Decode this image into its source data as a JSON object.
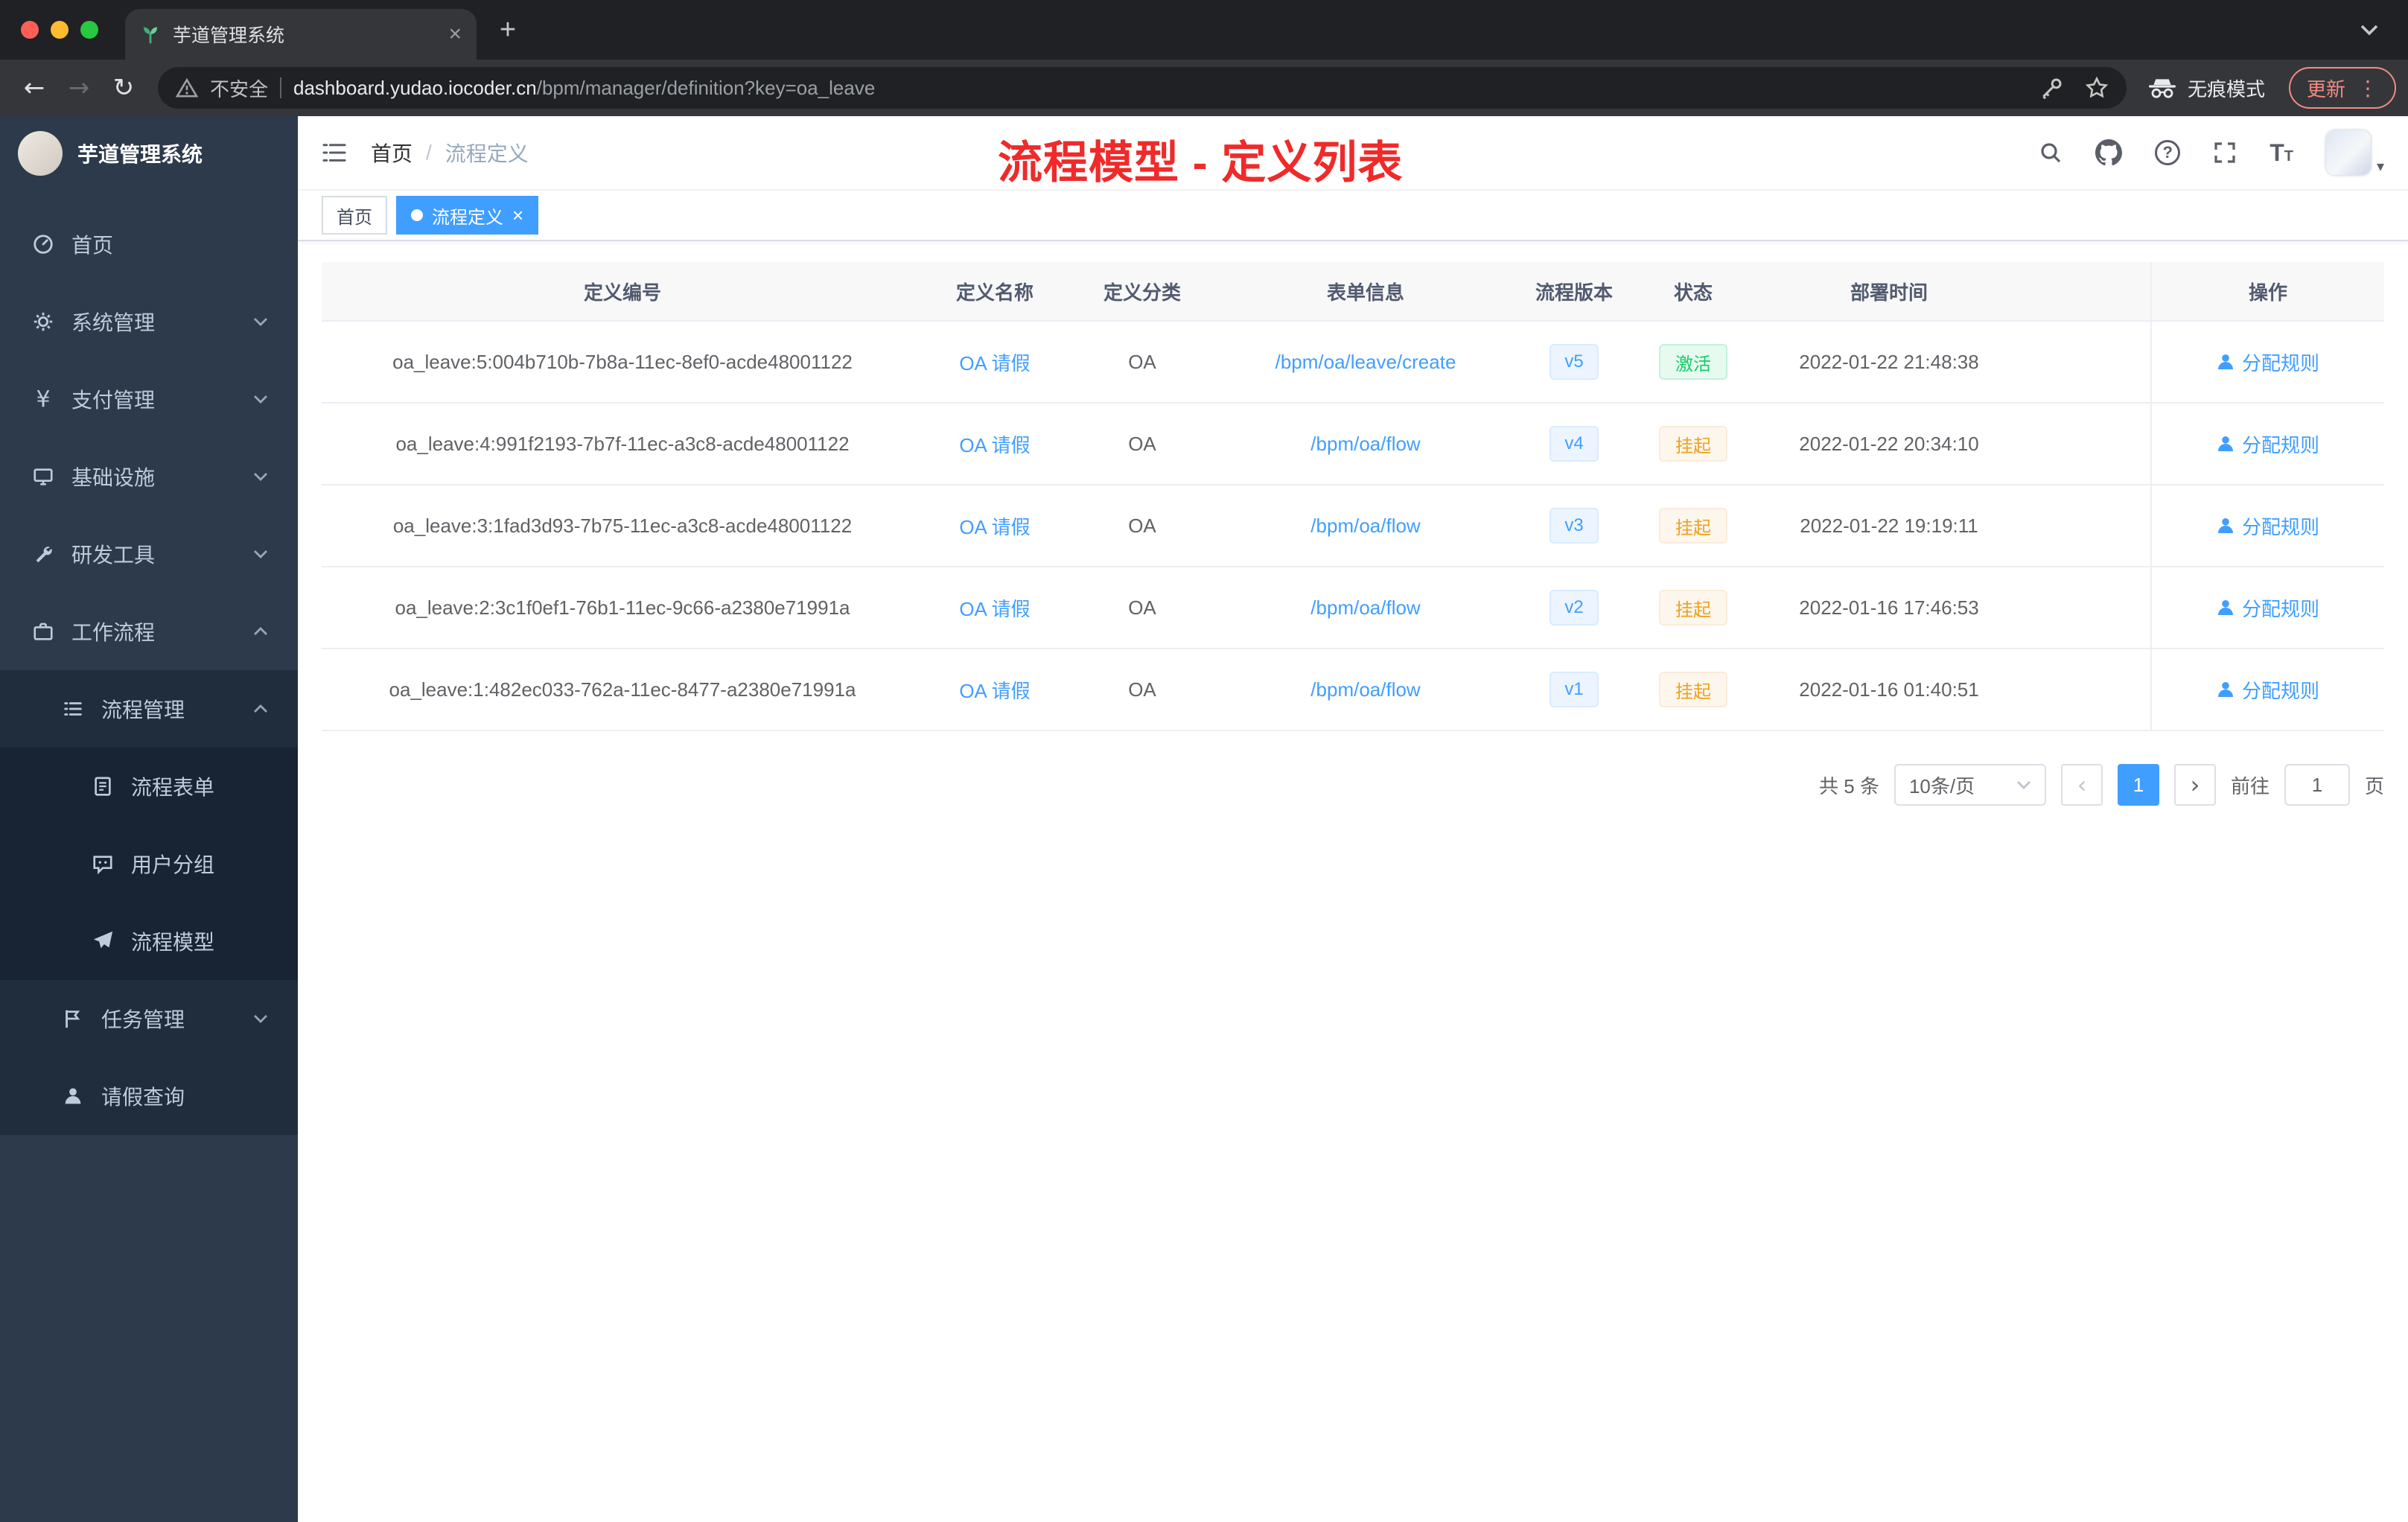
{
  "theme": {
    "accent": "#409eff",
    "annotation_red": "#f02a2a",
    "success_green": "#13ce66",
    "warning_orange": "#f0a020",
    "sidebar_bg": "#2d3a4b",
    "submenu_bg": "#1f2d3d"
  },
  "icons": {
    "yen": "¥",
    "back_arrow": "←",
    "forward_arrow": "→",
    "reload": "↻",
    "kebab": "⋮",
    "tab_close": "×",
    "new_tab": "+",
    "prev": "‹",
    "next": "›",
    "help": "?",
    "text_size_large": "T",
    "text_size_small": "T",
    "tag_close": "×",
    "caret_down": "▾"
  },
  "browser": {
    "tab": {
      "title": "芋道管理系统"
    },
    "address": {
      "security_label": "不安全",
      "host": "dashboard.yudao.iocoder.cn",
      "path": "/bpm/manager/definition?key=oa_leave"
    },
    "incognito_label": "无痕模式",
    "update_label": "更新"
  },
  "sidebar": {
    "app_title": "芋道管理系统",
    "items": [
      {
        "label": "首页"
      },
      {
        "label": "系统管理"
      },
      {
        "label": "支付管理"
      },
      {
        "label": "基础设施"
      },
      {
        "label": "研发工具"
      },
      {
        "label": "工作流程"
      },
      {
        "label": "流程管理"
      },
      {
        "label": "流程表单"
      },
      {
        "label": "用户分组"
      },
      {
        "label": "流程模型"
      },
      {
        "label": "任务管理"
      },
      {
        "label": "请假查询"
      }
    ]
  },
  "header": {
    "breadcrumb": {
      "home": "首页",
      "separator": "/",
      "current": "流程定义"
    },
    "annotation": "流程模型 - 定义列表"
  },
  "tags": {
    "home": "首页",
    "active": "流程定义"
  },
  "table": {
    "columns": {
      "id": "定义编号",
      "name": "定义名称",
      "category": "定义分类",
      "form": "表单信息",
      "version": "流程版本",
      "status": "状态",
      "deploy_time": "部署时间",
      "actions": "操作"
    },
    "rows": [
      {
        "id": "oa_leave:5:004b710b-7b8a-11ec-8ef0-acde48001122",
        "name": "OA 请假",
        "category": "OA",
        "form": "/bpm/oa/leave/create",
        "version": "v5",
        "status": "激活",
        "time": "2022-01-22 21:48:38",
        "action": "分配规则"
      },
      {
        "id": "oa_leave:4:991f2193-7b7f-11ec-a3c8-acde48001122",
        "name": "OA 请假",
        "category": "OA",
        "form": "/bpm/oa/flow",
        "version": "v4",
        "status": "挂起",
        "time": "2022-01-22 20:34:10",
        "action": "分配规则"
      },
      {
        "id": "oa_leave:3:1fad3d93-7b75-11ec-a3c8-acde48001122",
        "name": "OA 请假",
        "category": "OA",
        "form": "/bpm/oa/flow",
        "version": "v3",
        "status": "挂起",
        "time": "2022-01-22 19:19:11",
        "action": "分配规则"
      },
      {
        "id": "oa_leave:2:3c1f0ef1-76b1-11ec-9c66-a2380e71991a",
        "name": "OA 请假",
        "category": "OA",
        "form": "/bpm/oa/flow",
        "version": "v2",
        "status": "挂起",
        "time": "2022-01-16 17:46:53",
        "action": "分配规则"
      },
      {
        "id": "oa_leave:1:482ec033-762a-11ec-8477-a2380e71991a",
        "name": "OA 请假",
        "category": "OA",
        "form": "/bpm/oa/flow",
        "version": "v1",
        "status": "挂起",
        "time": "2022-01-16 01:40:51",
        "action": "分配规则"
      }
    ]
  },
  "pagination": {
    "total": "共 5 条",
    "page_size": "10条/页",
    "page": "1",
    "goto": "前往",
    "goto_value": "1",
    "unit": "页"
  }
}
